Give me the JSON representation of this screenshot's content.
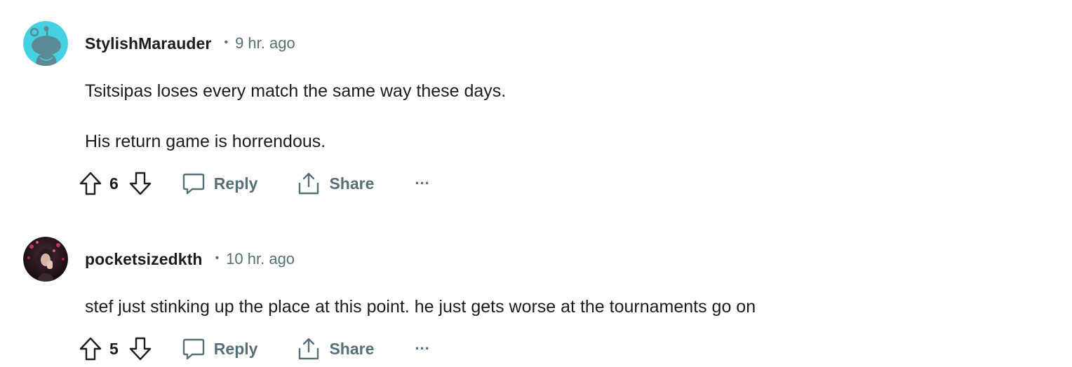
{
  "comments": [
    {
      "username": "StylishMarauder",
      "separator": "•",
      "time": "9 hr. ago",
      "body": [
        "Tsitsipas loses every match the same way these days.",
        "His return game is horrendous."
      ],
      "votes": "6",
      "reply_label": "Reply",
      "share_label": "Share",
      "more_label": "...",
      "avatar": {
        "type": "reddit-snoo-icon",
        "bg_color": "#46d1e3",
        "fg_color": "#5b8a94"
      }
    },
    {
      "username": "pocketsizedkth",
      "separator": "•",
      "time": "10 hr. ago",
      "body": [
        "stef just stinking up the place at this point. he just gets worse at the tournaments go on"
      ],
      "votes": "5",
      "reply_label": "Reply",
      "share_label": "Share",
      "more_label": "...",
      "avatar": {
        "type": "user-photo",
        "bg_color": "#2a1a22",
        "accent_color": "#c0395a"
      }
    }
  ],
  "colors": {
    "text": "#1c1c1c",
    "muted": "#576f76",
    "background": "#ffffff"
  }
}
